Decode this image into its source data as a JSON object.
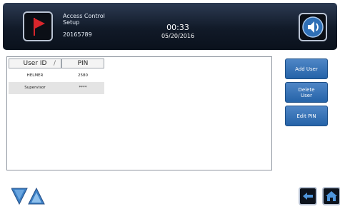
{
  "header": {
    "title": "Access Control Setup",
    "serial": "20165789",
    "time": "00:33",
    "date": "05/20/2016"
  },
  "table": {
    "columns": [
      "User ID",
      "PIN"
    ],
    "rows": [
      {
        "user_id": "HELMER",
        "pin": "2580"
      },
      {
        "user_id": "Supervisor",
        "pin": "****"
      }
    ]
  },
  "actions": {
    "add_user": "Add User",
    "delete_user": "Delete User",
    "edit_pin": "Edit PIN"
  },
  "icons": {
    "alarm_flag": "flag-icon",
    "sound": "speaker-icon",
    "navigation": "triangle-nav-icon",
    "back": "back-arrow-icon",
    "home": "home-icon"
  },
  "colors": {
    "header_bg": "#111a28",
    "button_blue": "#2563a8",
    "flag_red": "#d8262c",
    "nav_triangle": "#3b7fc4"
  }
}
